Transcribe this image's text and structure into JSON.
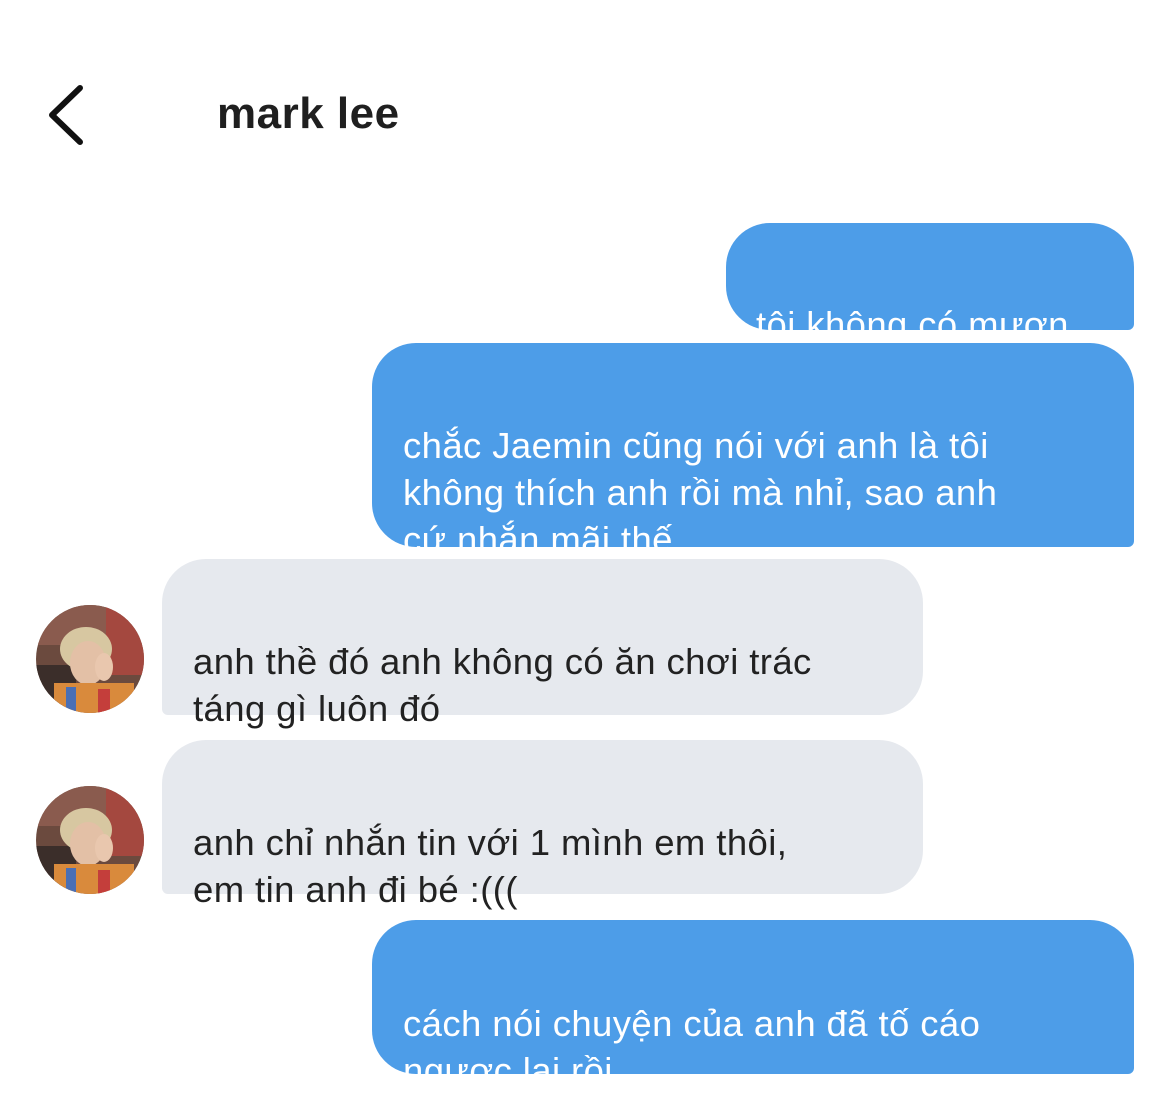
{
  "header": {
    "back_icon": "chevron-left-icon",
    "contact_name": "mark lee"
  },
  "messages": [
    {
      "from": "me",
      "text": "tôi không có mượn"
    },
    {
      "from": "me",
      "text": "chắc Jaemin cũng nói với anh là tôi\nkhông thích anh rồi mà nhỉ, sao anh\ncứ nhắn mãi thế"
    },
    {
      "from": "contact",
      "text": "anh thề đó anh không có ăn chơi trác\ntáng gì luôn đó"
    },
    {
      "from": "contact",
      "text": "anh chỉ nhắn tin với 1 mình em thôi,\nem tin anh đi bé :((("
    },
    {
      "from": "me",
      "text": "cách nói chuyện của anh đã tố cáo\nngược lại rồi"
    }
  ],
  "colors": {
    "sent_bubble": "#4d9de8",
    "received_bubble": "#e6e9ee",
    "title_text": "#1f1f1f"
  }
}
